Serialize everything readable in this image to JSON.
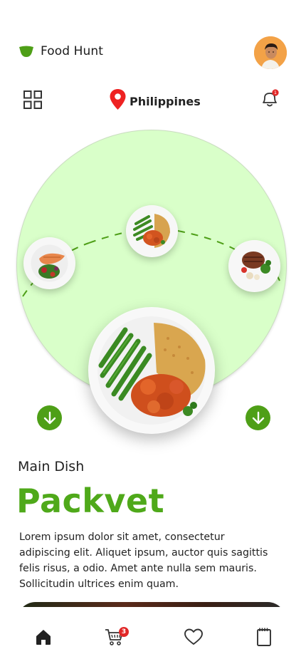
{
  "header": {
    "brand_name": "Food Hunt",
    "brand_color": "#4fa91a"
  },
  "nav": {
    "location": "Philippines",
    "notification_count": "1"
  },
  "hero": {
    "accent": "#d9ffc9",
    "plates": [
      "salmon-salad",
      "packvet",
      "steak-vegetables"
    ],
    "selected_plate": "packvet"
  },
  "dish": {
    "category": "Main Dish",
    "name": "Packvet",
    "description": "Lorem ipsum dolor sit amet, consectetur adipiscing elit. Aliquet ipsum, auctor quis sagittis felis risus, a odio. Amet ante nulla sem mauris. Sollicitudin ultrices enim quam."
  },
  "bottom_nav": {
    "items": [
      "home-icon",
      "cart-icon",
      "heart-icon",
      "orders-icon"
    ],
    "cart_count": "3",
    "active": "home-icon"
  }
}
